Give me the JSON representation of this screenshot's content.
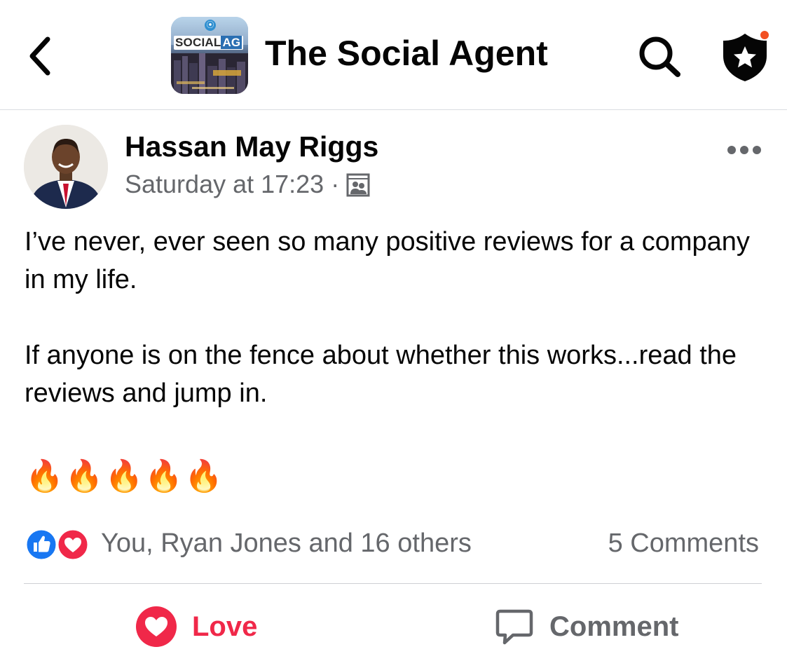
{
  "header": {
    "group_name": "The Social Agent",
    "group_logo_text": "SOCIAL",
    "group_logo_text_highlight": "AG",
    "back_icon": "chevron-left-icon",
    "search_icon": "search-icon",
    "admin_icon": "shield-star-icon",
    "admin_notification_color": "#f25022"
  },
  "post": {
    "author": "Hassan May Riggs",
    "timestamp": "Saturday at 17:23",
    "separator": "·",
    "audience_icon": "group-members-icon",
    "more_icon": "more-horizontal-icon",
    "paragraphs": [
      "I’ve never, ever seen so many positive reviews for a company in my life.",
      "If anyone is on the fence about whether this works...read the reviews and jump in."
    ],
    "emoji": "🔥🔥🔥🔥🔥"
  },
  "reactions": {
    "summary": "You, Ryan Jones and 16 others",
    "comments": "5 Comments",
    "like_color": "#1877f2",
    "love_color": "#f02849"
  },
  "actions": {
    "love_label": "Love",
    "comment_label": "Comment"
  }
}
